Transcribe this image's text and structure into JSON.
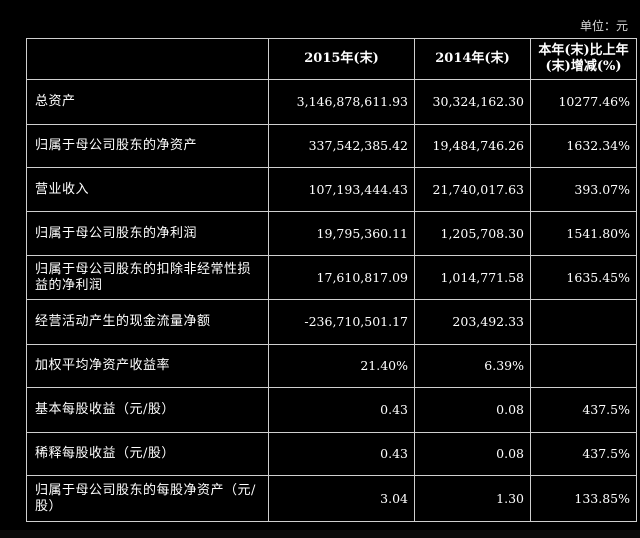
{
  "unit": "单位：元",
  "headers": [
    "",
    "2015年(末)",
    "2014年(末)",
    "本年(末)比上年(末)增减(%)"
  ],
  "rows": [
    {
      "label": "总资产",
      "v2015": "3,146,878,611.93",
      "v2014": "30,324,162.30",
      "change": "10277.46%"
    },
    {
      "label": "归属于母公司股东的净资产",
      "v2015": "337,542,385.42",
      "v2014": "19,484,746.26",
      "change": "1632.34%"
    },
    {
      "label": "营业收入",
      "v2015": "107,193,444.43",
      "v2014": "21,740,017.63",
      "change": "393.07%"
    },
    {
      "label": "归属于母公司股东的净利润",
      "v2015": "19,795,360.11",
      "v2014": "1,205,708.30",
      "change": "1541.80%"
    },
    {
      "label": "归属于母公司股东的扣除非经常性损益的净利润",
      "v2015": "17,610,817.09",
      "v2014": "1,014,771.58",
      "change": "1635.45%"
    },
    {
      "label": "经营活动产生的现金流量净额",
      "v2015": "-236,710,501.17",
      "v2014": "203,492.33",
      "change": ""
    },
    {
      "label": "加权平均净资产收益率",
      "v2015": "21.40%",
      "v2014": "6.39%",
      "change": ""
    },
    {
      "label": "基本每股收益（元/股）",
      "v2015": "0.43",
      "v2014": "0.08",
      "change": "437.5%"
    },
    {
      "label": "稀释每股收益（元/股）",
      "v2015": "0.43",
      "v2014": "0.08",
      "change": "437.5%"
    },
    {
      "label": "归属于母公司股东的每股净资产（元/股）",
      "v2015": "3.04",
      "v2014": "1.30",
      "change": "133.85%"
    }
  ]
}
